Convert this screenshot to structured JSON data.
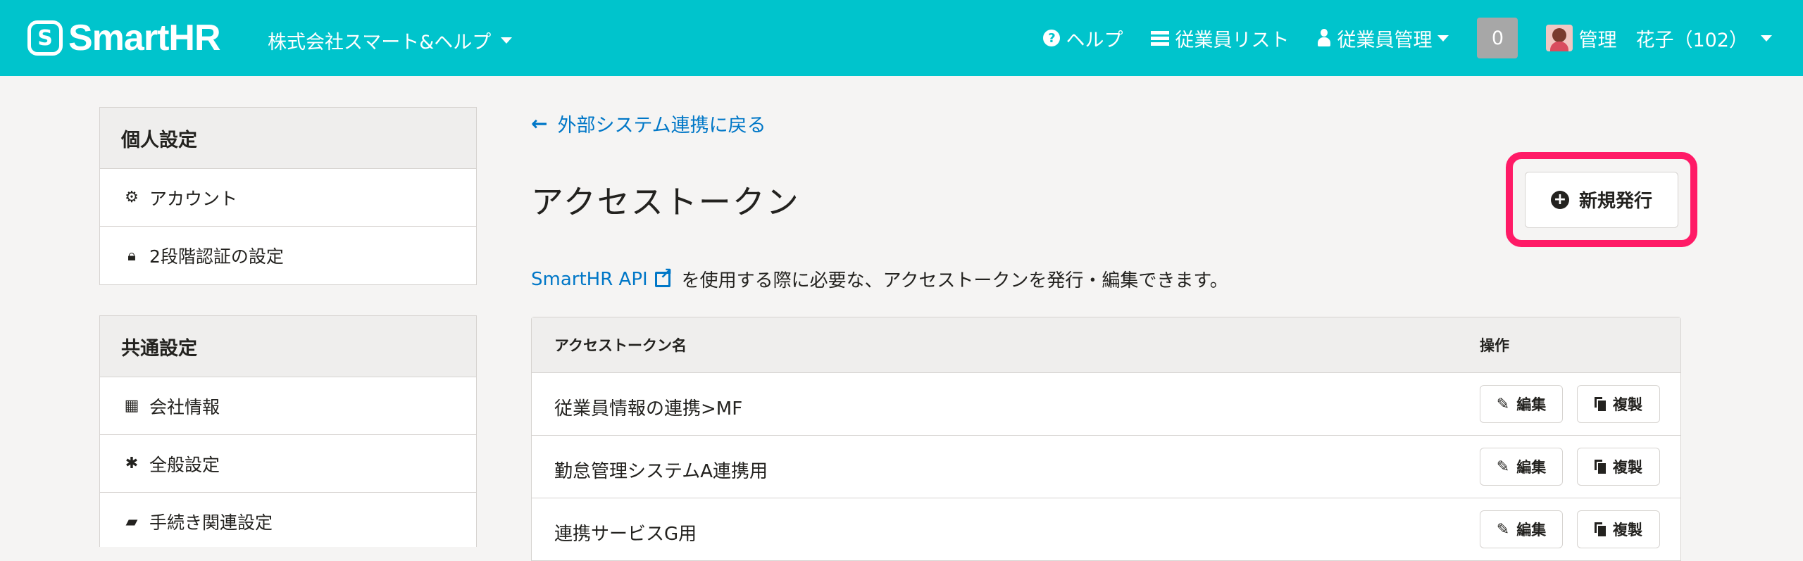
{
  "header": {
    "logo_mark": "S",
    "logo_text": "SmartHR",
    "company": "株式会社スマート&ヘルプ",
    "nav": {
      "help": "ヘルプ",
      "employee_list": "従業員リスト",
      "employee_mgmt": "従業員管理",
      "counter": "0",
      "user": "管理　花子（102）"
    }
  },
  "sidebar": {
    "personal": {
      "title": "個人設定",
      "items": [
        {
          "label": "アカウント",
          "icon": "gear-icon"
        },
        {
          "label": "2段階認証の設定",
          "icon": "lock-icon"
        }
      ]
    },
    "common": {
      "title": "共通設定",
      "items": [
        {
          "label": "会社情報",
          "icon": "building-icon"
        },
        {
          "label": "全般設定",
          "icon": "asterisk-icon"
        },
        {
          "label": "手続き関連設定",
          "icon": "book-icon"
        }
      ]
    }
  },
  "main": {
    "back_link": "外部システム連携に戻る",
    "title": "アクセストークン",
    "new_button": "新規発行",
    "desc_link": "SmartHR API",
    "desc_text": "を使用する際に必要な、アクセストークンを発行・編集できます。",
    "table": {
      "col_name": "アクセストークン名",
      "col_ops": "操作",
      "edit_label": "編集",
      "copy_label": "複製",
      "rows": [
        {
          "name": "従業員情報の連携>MF"
        },
        {
          "name": "勤怠管理システムA連携用"
        },
        {
          "name": "連携サービスG用"
        }
      ]
    }
  },
  "colors": {
    "header": "#00c4cc",
    "link": "#0077c7",
    "highlight": "#ff1a66"
  }
}
